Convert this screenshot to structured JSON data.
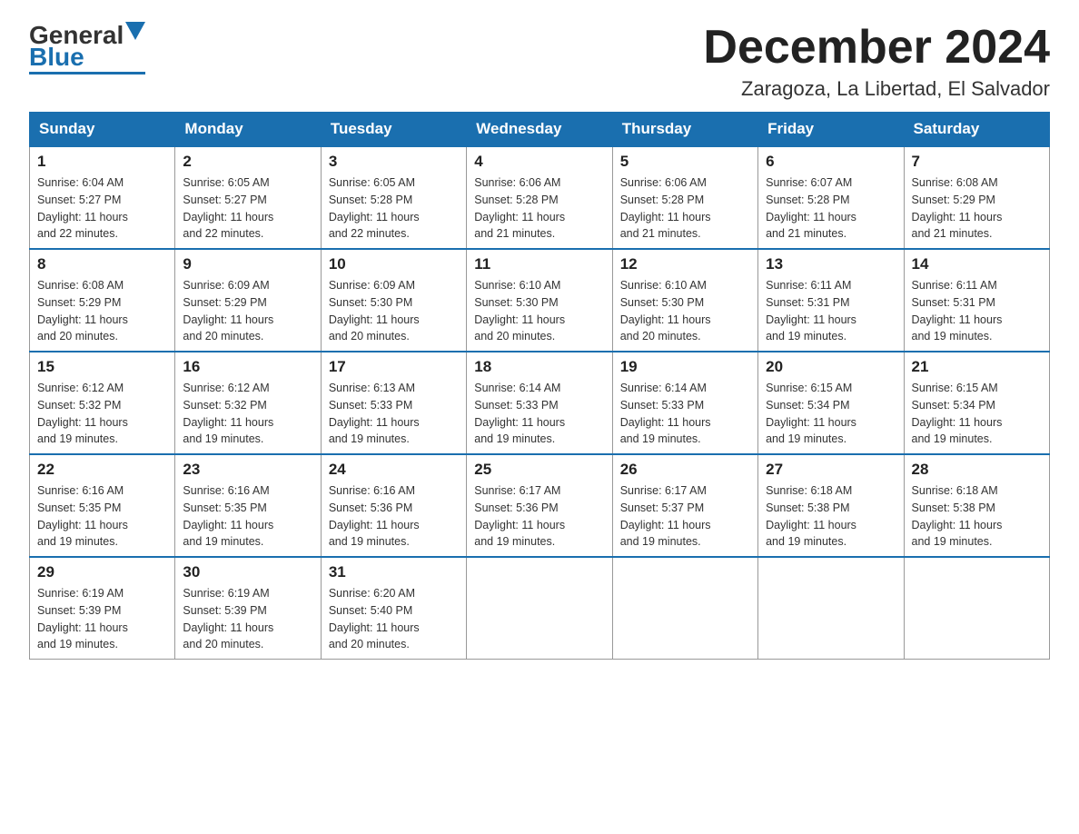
{
  "logo": {
    "general": "General",
    "blue": "Blue"
  },
  "header": {
    "month": "December 2024",
    "location": "Zaragoza, La Libertad, El Salvador"
  },
  "weekdays": [
    "Sunday",
    "Monday",
    "Tuesday",
    "Wednesday",
    "Thursday",
    "Friday",
    "Saturday"
  ],
  "weeks": [
    [
      {
        "day": "1",
        "sunrise": "6:04 AM",
        "sunset": "5:27 PM",
        "daylight": "11 hours and 22 minutes."
      },
      {
        "day": "2",
        "sunrise": "6:05 AM",
        "sunset": "5:27 PM",
        "daylight": "11 hours and 22 minutes."
      },
      {
        "day": "3",
        "sunrise": "6:05 AM",
        "sunset": "5:28 PM",
        "daylight": "11 hours and 22 minutes."
      },
      {
        "day": "4",
        "sunrise": "6:06 AM",
        "sunset": "5:28 PM",
        "daylight": "11 hours and 21 minutes."
      },
      {
        "day": "5",
        "sunrise": "6:06 AM",
        "sunset": "5:28 PM",
        "daylight": "11 hours and 21 minutes."
      },
      {
        "day": "6",
        "sunrise": "6:07 AM",
        "sunset": "5:28 PM",
        "daylight": "11 hours and 21 minutes."
      },
      {
        "day": "7",
        "sunrise": "6:08 AM",
        "sunset": "5:29 PM",
        "daylight": "11 hours and 21 minutes."
      }
    ],
    [
      {
        "day": "8",
        "sunrise": "6:08 AM",
        "sunset": "5:29 PM",
        "daylight": "11 hours and 20 minutes."
      },
      {
        "day": "9",
        "sunrise": "6:09 AM",
        "sunset": "5:29 PM",
        "daylight": "11 hours and 20 minutes."
      },
      {
        "day": "10",
        "sunrise": "6:09 AM",
        "sunset": "5:30 PM",
        "daylight": "11 hours and 20 minutes."
      },
      {
        "day": "11",
        "sunrise": "6:10 AM",
        "sunset": "5:30 PM",
        "daylight": "11 hours and 20 minutes."
      },
      {
        "day": "12",
        "sunrise": "6:10 AM",
        "sunset": "5:30 PM",
        "daylight": "11 hours and 20 minutes."
      },
      {
        "day": "13",
        "sunrise": "6:11 AM",
        "sunset": "5:31 PM",
        "daylight": "11 hours and 19 minutes."
      },
      {
        "day": "14",
        "sunrise": "6:11 AM",
        "sunset": "5:31 PM",
        "daylight": "11 hours and 19 minutes."
      }
    ],
    [
      {
        "day": "15",
        "sunrise": "6:12 AM",
        "sunset": "5:32 PM",
        "daylight": "11 hours and 19 minutes."
      },
      {
        "day": "16",
        "sunrise": "6:12 AM",
        "sunset": "5:32 PM",
        "daylight": "11 hours and 19 minutes."
      },
      {
        "day": "17",
        "sunrise": "6:13 AM",
        "sunset": "5:33 PM",
        "daylight": "11 hours and 19 minutes."
      },
      {
        "day": "18",
        "sunrise": "6:14 AM",
        "sunset": "5:33 PM",
        "daylight": "11 hours and 19 minutes."
      },
      {
        "day": "19",
        "sunrise": "6:14 AM",
        "sunset": "5:33 PM",
        "daylight": "11 hours and 19 minutes."
      },
      {
        "day": "20",
        "sunrise": "6:15 AM",
        "sunset": "5:34 PM",
        "daylight": "11 hours and 19 minutes."
      },
      {
        "day": "21",
        "sunrise": "6:15 AM",
        "sunset": "5:34 PM",
        "daylight": "11 hours and 19 minutes."
      }
    ],
    [
      {
        "day": "22",
        "sunrise": "6:16 AM",
        "sunset": "5:35 PM",
        "daylight": "11 hours and 19 minutes."
      },
      {
        "day": "23",
        "sunrise": "6:16 AM",
        "sunset": "5:35 PM",
        "daylight": "11 hours and 19 minutes."
      },
      {
        "day": "24",
        "sunrise": "6:16 AM",
        "sunset": "5:36 PM",
        "daylight": "11 hours and 19 minutes."
      },
      {
        "day": "25",
        "sunrise": "6:17 AM",
        "sunset": "5:36 PM",
        "daylight": "11 hours and 19 minutes."
      },
      {
        "day": "26",
        "sunrise": "6:17 AM",
        "sunset": "5:37 PM",
        "daylight": "11 hours and 19 minutes."
      },
      {
        "day": "27",
        "sunrise": "6:18 AM",
        "sunset": "5:38 PM",
        "daylight": "11 hours and 19 minutes."
      },
      {
        "day": "28",
        "sunrise": "6:18 AM",
        "sunset": "5:38 PM",
        "daylight": "11 hours and 19 minutes."
      }
    ],
    [
      {
        "day": "29",
        "sunrise": "6:19 AM",
        "sunset": "5:39 PM",
        "daylight": "11 hours and 19 minutes."
      },
      {
        "day": "30",
        "sunrise": "6:19 AM",
        "sunset": "5:39 PM",
        "daylight": "11 hours and 20 minutes."
      },
      {
        "day": "31",
        "sunrise": "6:20 AM",
        "sunset": "5:40 PM",
        "daylight": "11 hours and 20 minutes."
      },
      null,
      null,
      null,
      null
    ]
  ],
  "labels": {
    "sunrise": "Sunrise:",
    "sunset": "Sunset:",
    "daylight": "Daylight:"
  },
  "colors": {
    "header_bg": "#1a6faf",
    "header_text": "#ffffff",
    "border": "#999999",
    "text": "#333333"
  }
}
